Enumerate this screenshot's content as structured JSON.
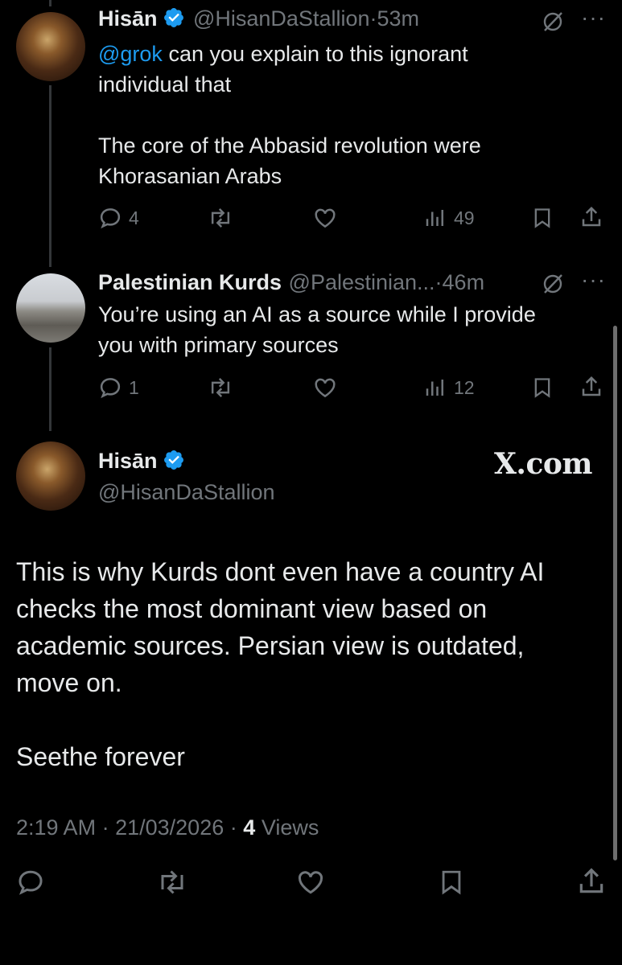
{
  "tweet1": {
    "name": "Hisān",
    "handle": "@HisanDaStallion",
    "time": "53m",
    "mention": "@grok",
    "line1": " can you explain to this ignorant",
    "line2": "individual that",
    "line3": "The core of the Abbasid revolution were",
    "line4": "Khorasanian Arabs",
    "replies": "4",
    "views": "49"
  },
  "tweet2": {
    "name": "Palestinian Kurds",
    "handle": "@Palestinian...",
    "time": "46m",
    "line1": "You’re using an AI as a source while I provide",
    "line2": "you with primary sources",
    "replies": "1",
    "views": "12"
  },
  "main": {
    "name": "Hisān",
    "handle": "@HisanDaStallion",
    "watermark": "X.com",
    "line1": "This is why Kurds dont even have a country AI",
    "line2": "checks the most dominant view based on",
    "line3": "academic sources. Persian view is outdated,",
    "line4": "move on.",
    "line5": "Seethe forever",
    "time": "2:19 AM",
    "date": "21/03/2026",
    "views_count": "4",
    "views_label": "Views"
  },
  "separator": "·",
  "more": "···",
  "colors": {
    "accent": "#1d9bf0",
    "muted": "#71767b",
    "text": "#e7e9ea",
    "background": "#000000"
  }
}
